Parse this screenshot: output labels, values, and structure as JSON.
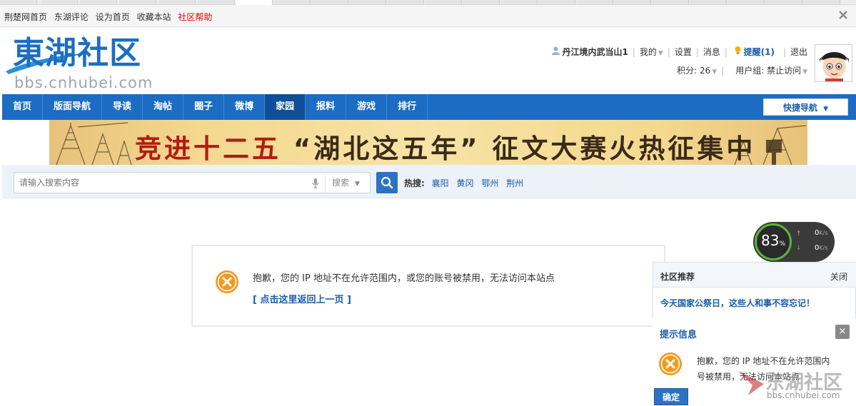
{
  "topbar": {
    "links": [
      "荆楚网首页",
      "东湖评论",
      "设为首页",
      "收藏本站"
    ],
    "help_link": "社区帮助"
  },
  "logo": {
    "cn": "東湖社区",
    "url": "bbs.cnhubei.com"
  },
  "user": {
    "name": "丹江境内武当山1",
    "my": "我的",
    "settings": "设置",
    "messages": "消息",
    "remind": "提醒(1)",
    "logout": "退出",
    "points": "积分: 26",
    "group": "用户组: 禁止访问"
  },
  "nav": {
    "items": [
      "首页",
      "版面导航",
      "导读",
      "淘帖",
      "圈子",
      "微博",
      "家园",
      "报料",
      "游戏",
      "排行"
    ],
    "active_index": 6,
    "quick_nav": "快捷导航"
  },
  "banner": {
    "part1": "竞进十二五 ",
    "part2": "“湖北这五年”",
    "part3": " 征文大赛火热征集中"
  },
  "search": {
    "placeholder": "请输入搜索内容",
    "type": "搜索",
    "hot_label": "热搜:",
    "hot_words": [
      "襄阳",
      "黄冈",
      "鄂州",
      "荆州"
    ]
  },
  "error": {
    "message": "抱歉，您的 IP 地址不在允许范围内，或您的账号被禁用，无法访问本站点",
    "back_link": "[ 点击这里返回上一页 ]"
  },
  "speed": {
    "percent": "83",
    "percent_unit": "%",
    "up": "0",
    "down": "0",
    "unit": "K/s"
  },
  "recommend": {
    "title": "社区推荐",
    "close": "关闭",
    "link": "今天国家公祭日，这些人和事不容忘记！"
  },
  "notice": {
    "title": "提示信息",
    "close_glyph": "×",
    "message_line1": "抱歉，您的 IP 地址不在允许范围内",
    "message_line2": "号被禁用，无法访问本站点",
    "ok": "确定"
  },
  "watermark": {
    "text": "东湖社区",
    "url": "bbs.cnhubei.com"
  },
  "colors": {
    "brand_blue": "#1c6cc3",
    "nav_active": "#0f4f97",
    "link_blue": "#1a5da6",
    "error_orange": "#f39a1e",
    "help_red": "#e60000"
  }
}
